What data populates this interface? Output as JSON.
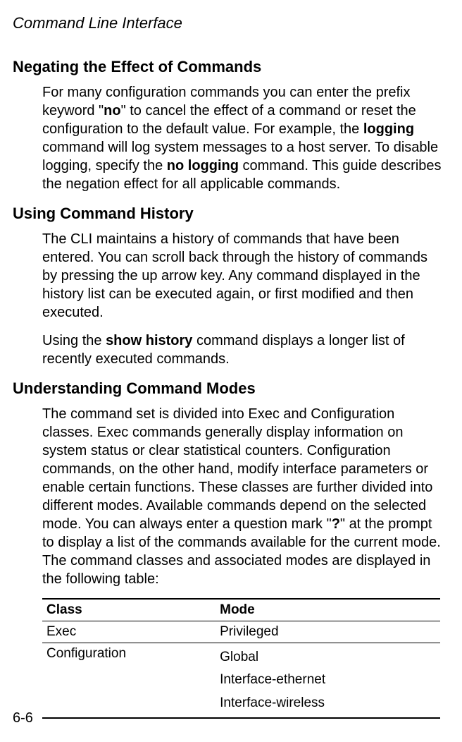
{
  "running_header": "Command Line Interface",
  "page_number": "6-6",
  "section1": {
    "heading": "Negating the Effect of Commands",
    "para1_pre": "For many configuration commands you can enter the prefix keyword \"",
    "para1_kw_no": "no",
    "para1_mid1": "\" to cancel the effect of a command or reset the configuration to the default value. For example, the ",
    "para1_kw_logging": "logging",
    "para1_mid2": " command will log system messages to a host server. To disable logging, specify the ",
    "para1_kw_nologging": "no logging",
    "para1_post": " command. This guide describes the negation effect for all applicable commands."
  },
  "section2": {
    "heading": "Using Command History",
    "para1": "The CLI maintains a history of commands that have been entered. You can scroll back through the history of commands by pressing the up arrow key. Any command displayed in the history list can be executed again, or first modified and then executed.",
    "para2_pre": "Using the ",
    "para2_kw": "show history",
    "para2_post": " command displays a longer list of recently executed commands."
  },
  "section3": {
    "heading": "Understanding Command Modes",
    "para1_pre": "The command set is divided into Exec and Configuration classes. Exec commands generally display information on system status or clear statistical counters. Configuration commands, on the other hand, modify interface parameters or enable certain functions. These classes are further divided into different modes. Available commands depend on the selected mode. You can always enter a question mark \"",
    "para1_kw_q": "?",
    "para1_post": "\" at the prompt to display a list of the commands available for the current mode. The command classes and associated modes are displayed in the following table:"
  },
  "table": {
    "header_class": "Class",
    "header_mode": "Mode",
    "row1_class": "Exec",
    "row1_mode": "Privileged",
    "row2_class": "Configuration",
    "row2_mode1": "Global",
    "row2_mode2": "Interface-ethernet",
    "row2_mode3": "Interface-wireless"
  }
}
